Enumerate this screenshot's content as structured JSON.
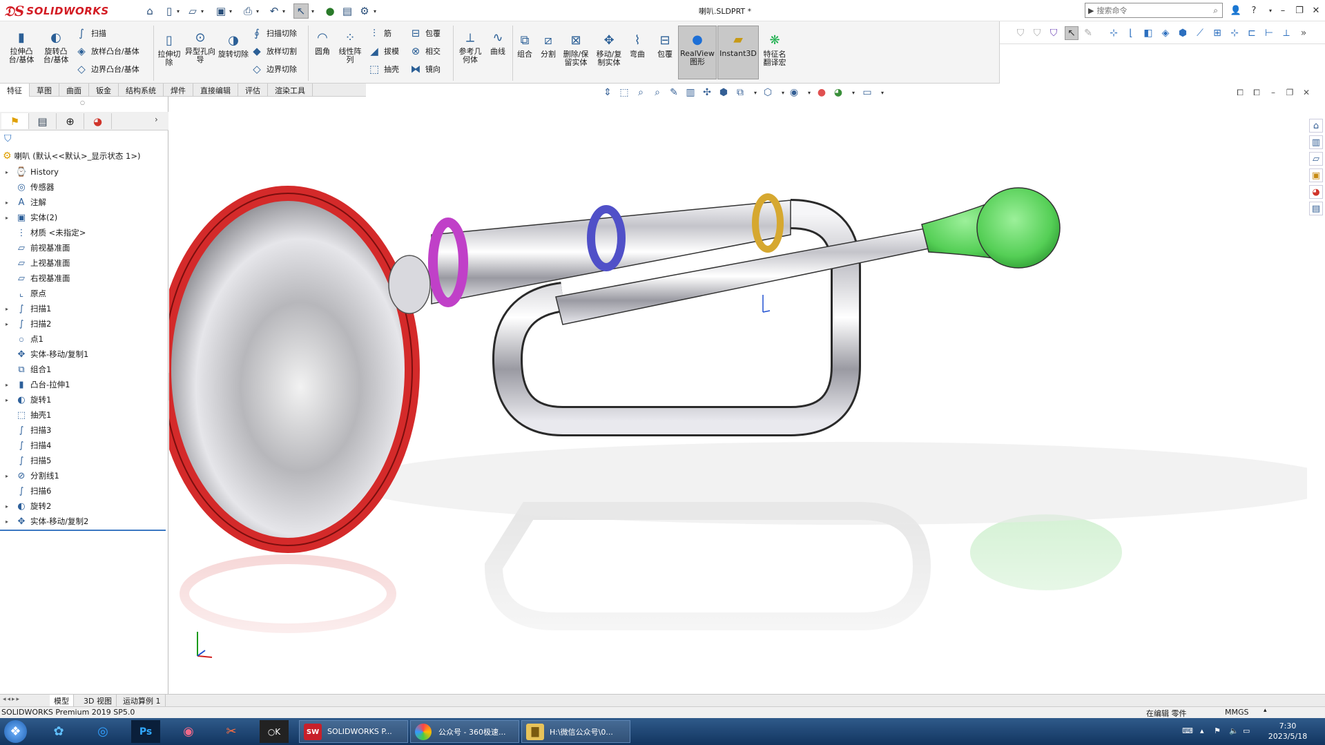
{
  "titlebar": {
    "brand": "SOLIDWORKS",
    "doc_title": "喇叭.SLDPRT *",
    "search_placeholder": "搜索命令"
  },
  "ribbon": {
    "extrude_boss": "拉伸凸台/基体",
    "revolve_boss": "旋转凸台/基体",
    "sweep": "扫描",
    "loft_boss": "放样凸台/基体",
    "boundary_boss": "边界凸台/基体",
    "extrude_cut": "拉伸切除",
    "hole_wizard": "异型孔向导",
    "revolve_cut": "旋转切除",
    "sweep_cut": "扫描切除",
    "loft_cut": "放样切割",
    "boundary_cut": "边界切除",
    "fillet": "圆角",
    "linear_pattern": "线性阵列",
    "rib": "筋",
    "draft": "拔模",
    "shell": "抽壳",
    "wrap": "包覆",
    "intersect": "相交",
    "mirror": "镜向",
    "ref_geometry": "参考几何体",
    "curves": "曲线",
    "combine": "组合",
    "split": "分割",
    "delete_body": "删除/保留实体",
    "move_body": "移动/复制实体",
    "flex": "弯曲",
    "wrap2": "包覆",
    "realview": "RealView图形",
    "instant3d": "Instant3D",
    "feature_translate": "特征名翻译宏"
  },
  "tabs": [
    "特征",
    "草图",
    "曲面",
    "钣金",
    "结构系统",
    "焊件",
    "直接编辑",
    "评估",
    "渲染工具"
  ],
  "tree": {
    "root": "喇叭 (默认<<默认>_显示状态 1>)",
    "items": [
      "History",
      "传感器",
      "注解",
      "实体(2)",
      "材质 <未指定>",
      "前视基准面",
      "上视基准面",
      "右视基准面",
      "原点",
      "扫描1",
      "扫描2",
      "点1",
      "实体-移动/复制1",
      "组合1",
      "凸台-拉伸1",
      "旋转1",
      "抽壳1",
      "扫描3",
      "扫描4",
      "扫描5",
      "分割线1",
      "扫描6",
      "旋转2",
      "实体-移动/复制2"
    ]
  },
  "bottom_tabs": [
    "模型",
    "3D 视图",
    "运动算例 1"
  ],
  "status": {
    "product": "SOLIDWORKS Premium 2019 SP5.0",
    "mode": "在编辑 零件",
    "units": "MMGS"
  },
  "taskbar": {
    "sw_window": "SOLIDWORKS P...",
    "browser_window": "公众号 - 360极速...",
    "folder_window": "H:\\微信公众号\\0...",
    "time": "7:30",
    "date": "2023/5/18"
  }
}
